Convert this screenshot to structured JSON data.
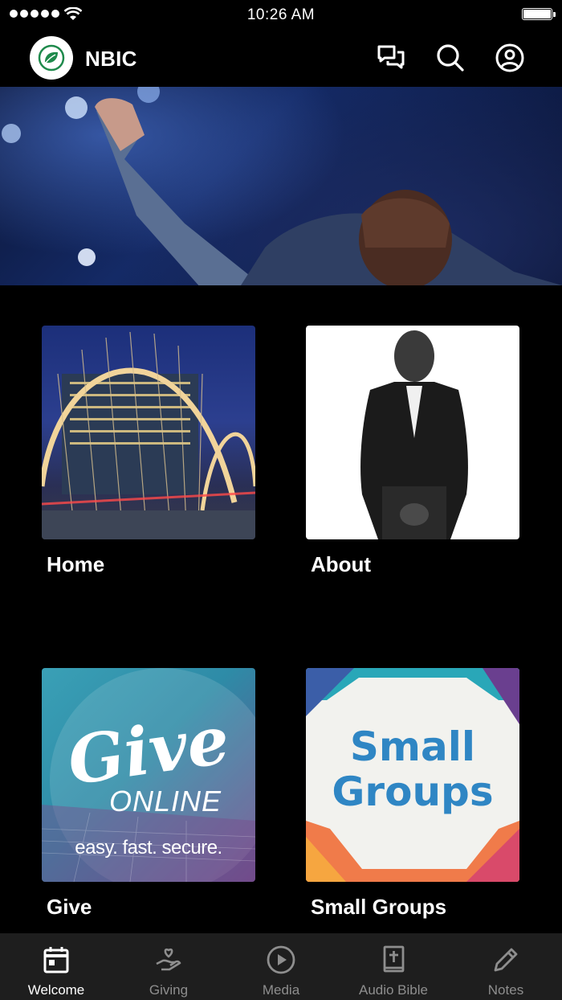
{
  "status_bar": {
    "time": "10:26 AM",
    "signal_icon": "signal-dots-icon",
    "wifi_icon": "wifi-icon",
    "battery_icon": "battery-icon"
  },
  "header": {
    "title": "NBIC",
    "logo_icon": "leaf-logo-icon",
    "actions": [
      {
        "name": "messages",
        "icon": "chat-bubbles-icon"
      },
      {
        "name": "search",
        "icon": "search-icon"
      },
      {
        "name": "profile",
        "icon": "account-circle-icon"
      }
    ]
  },
  "hero": {
    "image": "concert-performer-photo"
  },
  "tiles": [
    {
      "label": "Home",
      "image": "illuminated-arch-bridge-photo"
    },
    {
      "label": "About",
      "image": "pastor-portrait-photo"
    },
    {
      "label": "Give",
      "image": "give-online-graphic",
      "script": "Give",
      "subtitle": "ONLINE",
      "tagline": "easy. fast. secure."
    },
    {
      "label": "Small Groups",
      "image": "small-groups-graphic",
      "line1": "Small",
      "line2": "Groups"
    }
  ],
  "tabbar": {
    "items": [
      {
        "label": "Welcome",
        "icon": "calendar-icon",
        "active": true
      },
      {
        "label": "Giving",
        "icon": "hand-heart-icon",
        "active": false
      },
      {
        "label": "Media",
        "icon": "play-circle-icon",
        "active": false
      },
      {
        "label": "Audio Bible",
        "icon": "bible-icon",
        "active": false
      },
      {
        "label": "Notes",
        "icon": "pencil-icon",
        "active": false
      }
    ]
  },
  "colors": {
    "background": "#000000",
    "tabbar_bg": "#1e1e1e",
    "active_tab": "#ffffff",
    "inactive_tab": "#8e8e8e",
    "accent_green": "#1f8a4c",
    "groups_blue": "#2f86c4"
  }
}
